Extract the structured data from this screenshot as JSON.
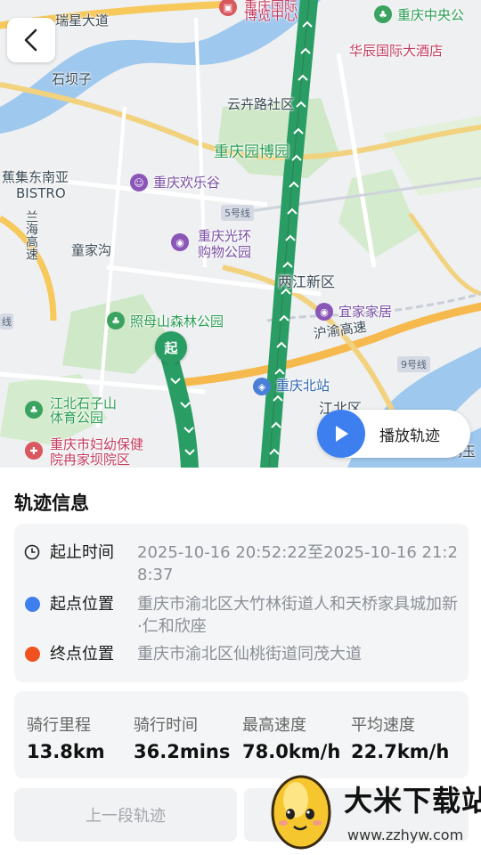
{
  "map": {
    "labels": {
      "rd_top": "瑞星大道",
      "museum_a": "重庆国际",
      "museum_b": "博览中心",
      "zhongyang": "重庆中央公",
      "huachen": "华辰国际大酒店",
      "shiba": "石坝子",
      "yunsheng": "云卉路社区",
      "garden": "重庆园博园",
      "bistro_a": "蕉集东南亚",
      "bistro_b": "BISTRO",
      "happy": "重庆欢乐谷",
      "line5": "5号线",
      "guanghuan_a": "重庆光环",
      "guanghuan_b": "购物公园",
      "lanhai": "兰海高速",
      "tongjia": "童家沟",
      "liangjiang": "两江新区",
      "zhaomu": "照母山森林公园",
      "yijia": "宜家家居",
      "huyu": "沪渝高速",
      "line9": "9号线",
      "north_station": "重庆北站",
      "jiangbei_q": "江北区",
      "shizishan_a": "江北石子山",
      "shizishan_b": "体育公园",
      "hospital_a": "重庆市妇幼保健",
      "hospital_b": "院冉家坝院区",
      "edge_r": "鸿玉",
      "edge_l": "线"
    },
    "start_marker": "起",
    "play_label": "播放轨迹"
  },
  "sheet": {
    "title": "轨迹信息",
    "rows": [
      {
        "icon": "clock-icon",
        "key": "起止时间",
        "value": "2025-10-16 20:52:22至2025-10-16 21:28:37"
      },
      {
        "icon": "blue-dot",
        "key": "起点位置",
        "value": "重庆市渝北区大竹林街道人和天桥家具城加新·仁和欣座"
      },
      {
        "icon": "orange-dot",
        "key": "终点位置",
        "value": "重庆市渝北区仙桃街道同茂大道"
      }
    ],
    "stats": [
      {
        "label": "骑行里程",
        "value": "13.8km"
      },
      {
        "label": "骑行时间",
        "value": "36.2mins"
      },
      {
        "label": "最高速度",
        "value": "78.0km/h"
      },
      {
        "label": "平均速度",
        "value": "22.7km/h"
      }
    ],
    "prev_label": "上一段轨迹"
  },
  "watermark": {
    "brand": "大米下载站",
    "url": "www.zzhyw.com"
  },
  "colors": {
    "track": "#2a9d64",
    "start_dot": "#3e7ff0",
    "end_dot": "#f0521f",
    "play_button": "#3e7ff0"
  }
}
